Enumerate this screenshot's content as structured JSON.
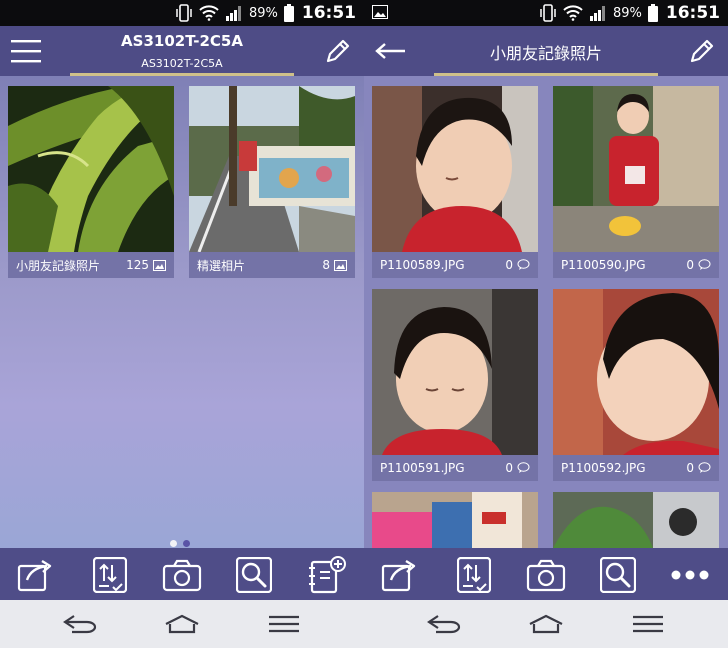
{
  "status": {
    "battery_pct": "89%",
    "time": "16:51"
  },
  "left": {
    "title": "AS3102T-2C5A",
    "subtitle": "AS3102T-2C5A",
    "albums": [
      {
        "name": "小朋友記錄照片",
        "count": "125"
      },
      {
        "name": "精選相片",
        "count": "8"
      }
    ]
  },
  "right": {
    "title": "小朋友記錄照片",
    "photos": [
      {
        "name": "P1100589.JPG",
        "comments": "0"
      },
      {
        "name": "P1100590.JPG",
        "comments": "0"
      },
      {
        "name": "P1100591.JPG",
        "comments": "0"
      },
      {
        "name": "P1100592.JPG",
        "comments": "0"
      }
    ]
  },
  "colors": {
    "appbar": "#4e4c86",
    "accent_underline": "#cfc08a",
    "toolbar": "#4f4d88",
    "navbar": "#e9eaee"
  },
  "icons": {
    "menu": "hamburger-menu-icon",
    "edit": "pencil-icon",
    "back": "arrow-left-icon",
    "share": "share-icon",
    "sort": "sort-icon",
    "camera": "camera-icon",
    "search": "search-icon",
    "add_album": "add-album-icon",
    "more": "more-icon"
  }
}
